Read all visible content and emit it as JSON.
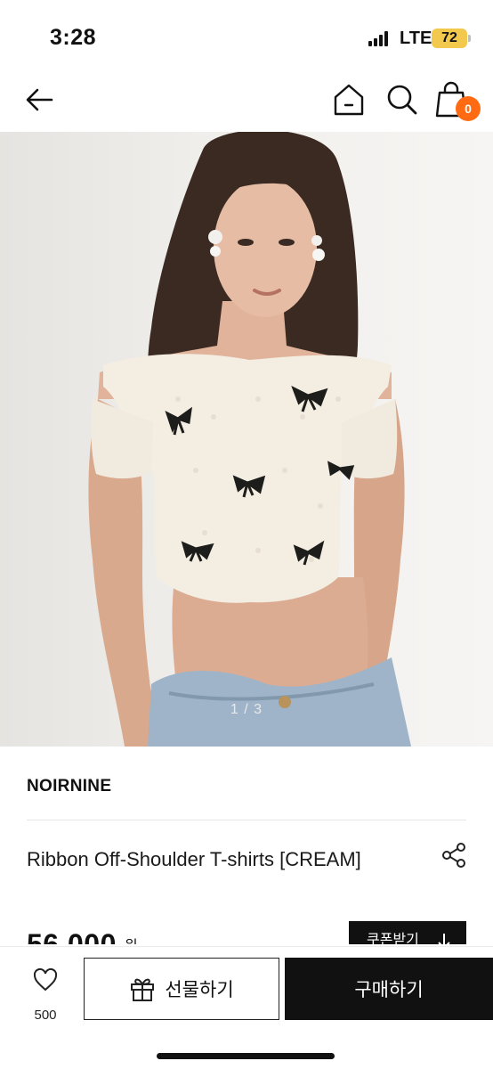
{
  "status_bar": {
    "time": "3:28",
    "network": "LTE",
    "battery": "72"
  },
  "header": {
    "cart_count": "0"
  },
  "gallery": {
    "indicator": "1 / 3"
  },
  "product": {
    "brand": "NOIRNINE",
    "title": "Ribbon Off-Shoulder T-shirts [CREAM]",
    "price": "56,000",
    "currency": "원",
    "coupon_label": "쿠폰받기"
  },
  "bottom_bar": {
    "like_count": "500",
    "gift_label": "선물하기",
    "buy_label": "구매하기"
  },
  "colors": {
    "accent": "#ff6a13",
    "dark": "#111111"
  },
  "icons": [
    "back-arrow-icon",
    "home-icon",
    "search-icon",
    "shopping-bag-icon",
    "share-icon",
    "heart-icon",
    "gift-icon",
    "chevron-down-icon"
  ]
}
